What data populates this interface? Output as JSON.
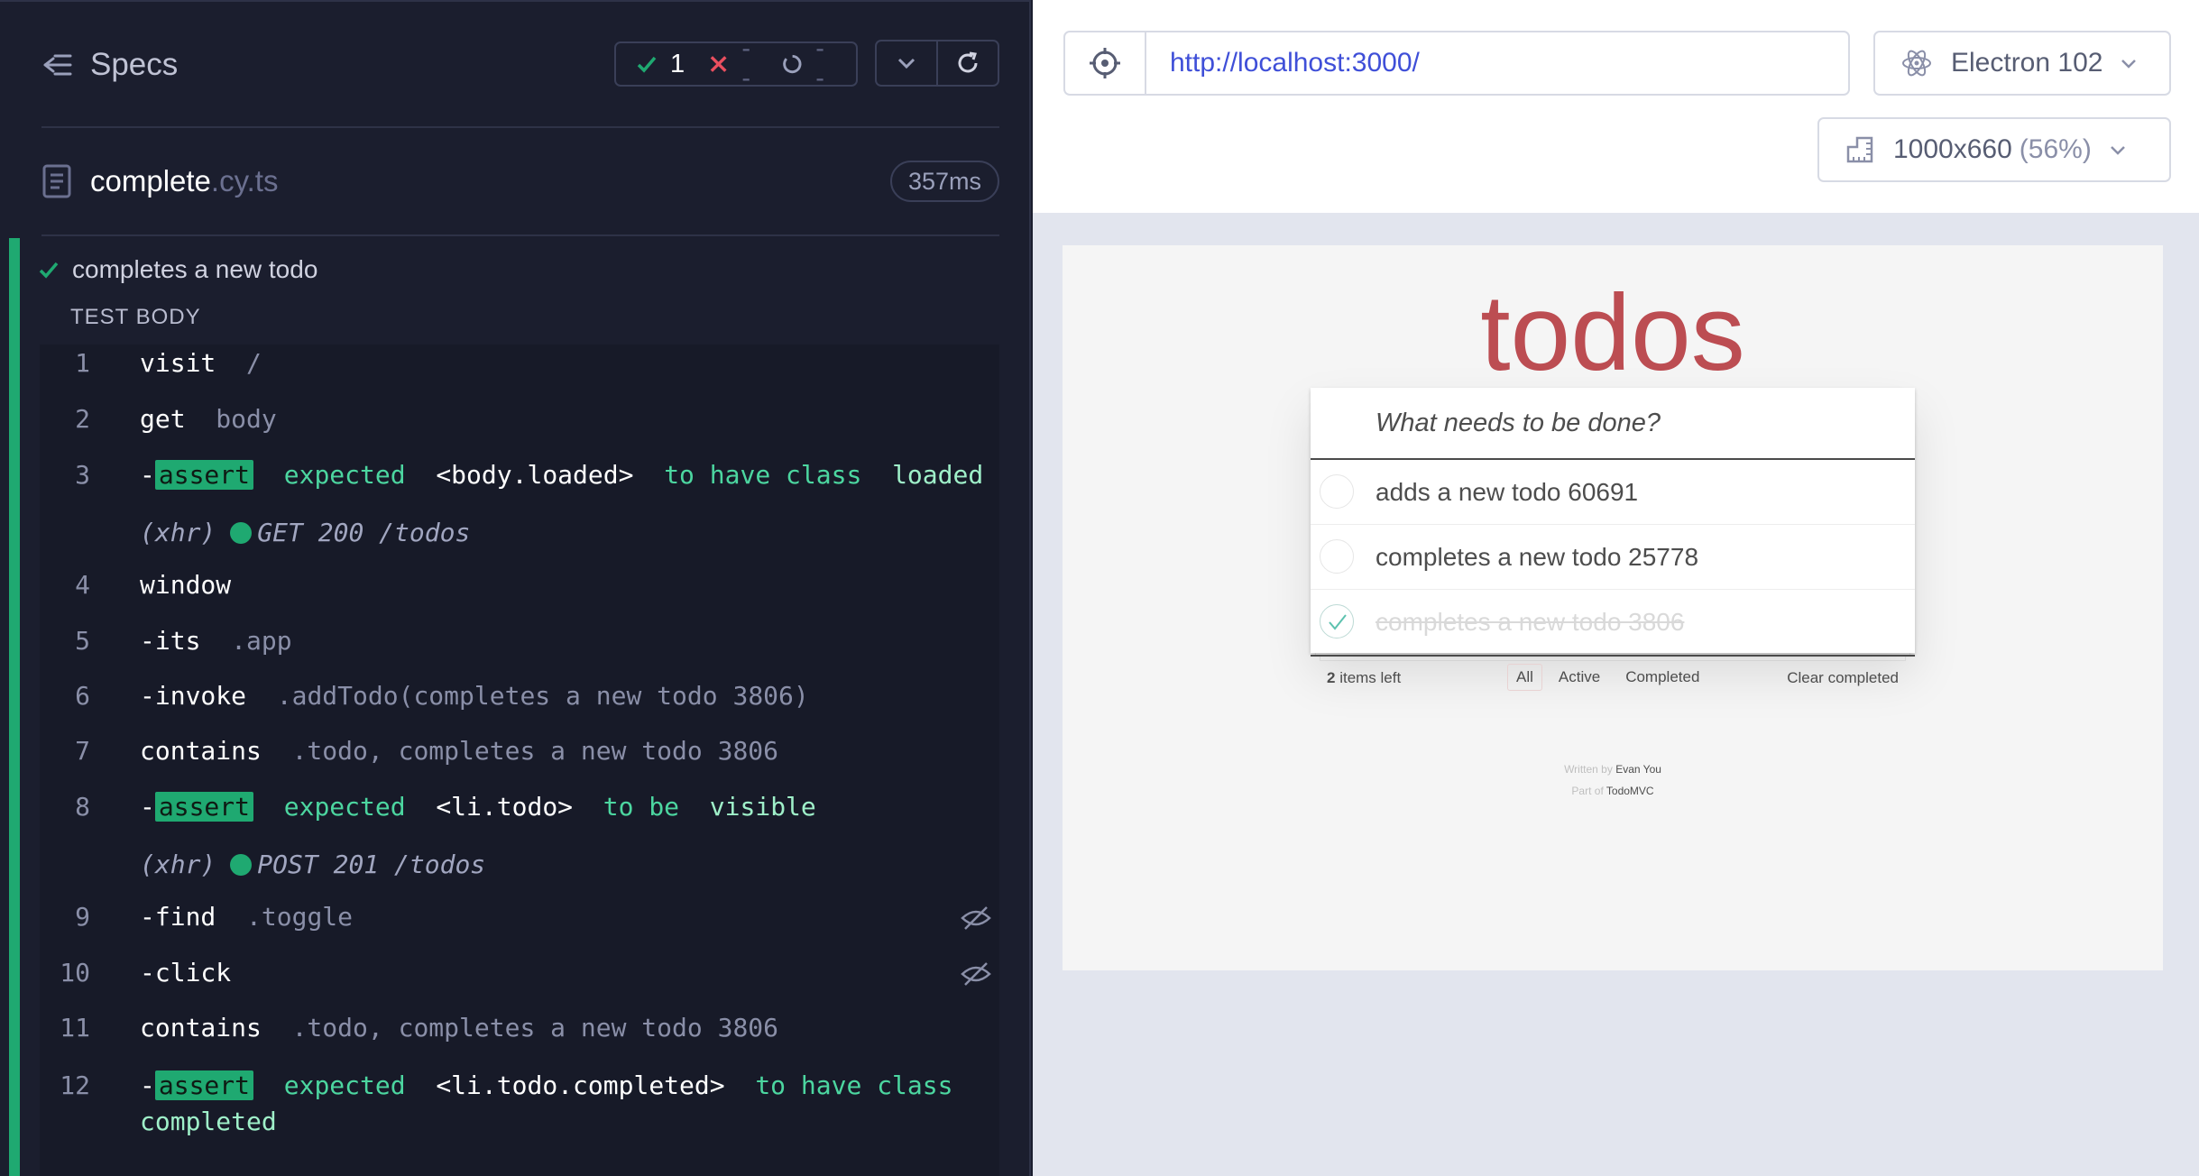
{
  "reporter": {
    "specs_label": "Specs",
    "stats": {
      "passed": "1",
      "failed": "--",
      "pending": "--"
    },
    "spec": {
      "name": "complete",
      "ext": ".cy.ts",
      "duration": "357ms"
    },
    "test_title": "completes a new todo",
    "section_label": "TEST BODY",
    "commands": [
      {
        "num": "1",
        "name": "visit",
        "arg": "/"
      },
      {
        "num": "2",
        "name": "get",
        "arg": "body"
      },
      {
        "num": "3",
        "assert": "assert",
        "msg": [
          "expected",
          "<body.loaded>",
          "to have class",
          "loaded"
        ]
      },
      {
        "xhr": "(xhr)",
        "request": "GET 200 /todos"
      },
      {
        "num": "4",
        "name": "window"
      },
      {
        "num": "5",
        "name": "-its",
        "arg": ".app"
      },
      {
        "num": "6",
        "name": "-invoke",
        "arg": ".addTodo(completes a new todo 3806)"
      },
      {
        "num": "7",
        "name": "contains",
        "arg": ".todo, completes a new todo 3806"
      },
      {
        "num": "8",
        "assert": "assert",
        "msg": [
          "expected",
          "<li.todo>",
          "to be",
          "visible"
        ]
      },
      {
        "xhr": "(xhr)",
        "request": "POST 201 /todos"
      },
      {
        "num": "9",
        "name": "-find",
        "arg": ".toggle"
      },
      {
        "num": "10",
        "name": "-click"
      },
      {
        "num": "11",
        "name": "contains",
        "arg": ".todo, completes a new todo 3806"
      },
      {
        "num": "12",
        "assert": "assert",
        "msg": [
          "expected",
          "<li.todo.completed>",
          "to have class",
          "completed"
        ]
      }
    ]
  },
  "aut": {
    "url": "http://localhost:3000/",
    "browser": "Electron 102",
    "viewport": "1000x660",
    "viewport_pct": "(56%)",
    "app": {
      "title": "todos",
      "placeholder": "What needs to be done?",
      "todos": [
        {
          "label": "adds a new todo 60691",
          "completed": false
        },
        {
          "label": "completes a new todo 25778",
          "completed": false
        },
        {
          "label": "completes a new todo 3806",
          "completed": true
        }
      ],
      "count_num": "2",
      "count_text": " items left",
      "filters": [
        "All",
        "Active",
        "Completed"
      ],
      "clear_completed": "Clear completed",
      "info_written_prefix": "Written by ",
      "info_written_name": "Evan You",
      "info_part_prefix": "Part of ",
      "info_part_name": "TodoMVC"
    }
  },
  "colors": {
    "pass": "#1fa971",
    "fail": "#e94f5f",
    "brand_red": "#b83f45",
    "url_blue": "#3f4fd8"
  },
  "icons": [
    "back-arrow-icon",
    "check-icon",
    "x-icon",
    "spinner-icon",
    "chevron-down-icon",
    "reload-icon",
    "file-icon",
    "eye-slash-icon",
    "crosshair-icon",
    "electron-icon",
    "ruler-icon"
  ]
}
